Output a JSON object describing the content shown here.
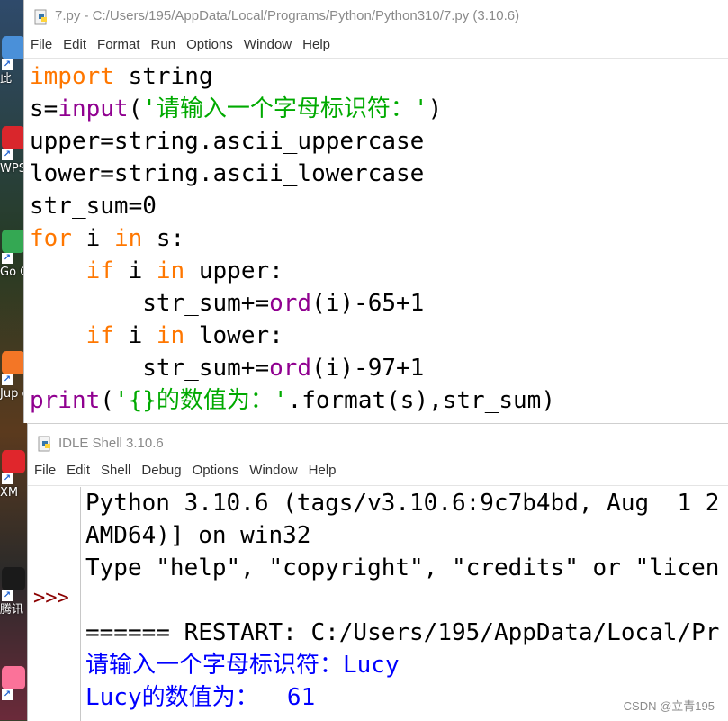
{
  "colors": {
    "keyword": "#ff7700",
    "builtin": "#900090",
    "string": "#00aa00",
    "text": "#000000",
    "stdout": "#0000ff",
    "prompt": "#8b0000"
  },
  "desktop": {
    "icons": [
      {
        "icon": "computer-icon",
        "label": "此",
        "color": "#4a90d9"
      },
      {
        "icon": "wps-icon",
        "label": "WPS",
        "color": "#d9262c"
      },
      {
        "icon": "chrome-icon",
        "label": "Go Chr",
        "color": "#34a853"
      },
      {
        "icon": "jupyter-icon",
        "label": "Jup ote",
        "color": "#f37626"
      },
      {
        "icon": "xmind-icon",
        "label": "XM",
        "color": "#e0262c"
      },
      {
        "icon": "qq-icon",
        "label": "腾讯",
        "color": "#1a1a1a"
      },
      {
        "icon": "bilibili-icon",
        "label": "",
        "color": "#fb7299"
      }
    ]
  },
  "editor": {
    "title": "7.py - C:/Users/195/AppData/Local/Programs/Python/Python310/7.py (3.10.6)",
    "menu": [
      "File",
      "Edit",
      "Format",
      "Run",
      "Options",
      "Window",
      "Help"
    ],
    "lines": [
      [
        {
          "t": "import",
          "c": "keyword"
        },
        {
          "t": " string",
          "c": "text"
        }
      ],
      [
        {
          "t": "s=",
          "c": "text"
        },
        {
          "t": "input",
          "c": "builtin"
        },
        {
          "t": "(",
          "c": "text"
        },
        {
          "t": "'请输入一个字母标识符：'",
          "c": "string"
        },
        {
          "t": ")",
          "c": "text"
        }
      ],
      [
        {
          "t": "upper=string.ascii_uppercase",
          "c": "text"
        }
      ],
      [
        {
          "t": "lower=string.ascii_lowercase",
          "c": "text"
        }
      ],
      [
        {
          "t": "str_sum=0",
          "c": "text"
        }
      ],
      [
        {
          "t": "for",
          "c": "keyword"
        },
        {
          "t": " i ",
          "c": "text"
        },
        {
          "t": "in",
          "c": "keyword"
        },
        {
          "t": " s:",
          "c": "text"
        }
      ],
      [
        {
          "t": "    ",
          "c": "text"
        },
        {
          "t": "if",
          "c": "keyword"
        },
        {
          "t": " i ",
          "c": "text"
        },
        {
          "t": "in",
          "c": "keyword"
        },
        {
          "t": " upper:",
          "c": "text"
        }
      ],
      [
        {
          "t": "        str_sum+=",
          "c": "text"
        },
        {
          "t": "ord",
          "c": "builtin"
        },
        {
          "t": "(i)-65+1",
          "c": "text"
        }
      ],
      [
        {
          "t": "    ",
          "c": "text"
        },
        {
          "t": "if",
          "c": "keyword"
        },
        {
          "t": " i ",
          "c": "text"
        },
        {
          "t": "in",
          "c": "keyword"
        },
        {
          "t": " lower:",
          "c": "text"
        }
      ],
      [
        {
          "t": "        str_sum+=",
          "c": "text"
        },
        {
          "t": "ord",
          "c": "builtin"
        },
        {
          "t": "(i)-97+1",
          "c": "text"
        }
      ],
      [
        {
          "t": "print",
          "c": "builtin"
        },
        {
          "t": "(",
          "c": "text"
        },
        {
          "t": "'{}的数值为：'",
          "c": "string"
        },
        {
          "t": ".format(s),str_sum)",
          "c": "text"
        }
      ]
    ]
  },
  "shell": {
    "title": "IDLE Shell 3.10.6",
    "menu": [
      "File",
      "Edit",
      "Shell",
      "Debug",
      "Options",
      "Window",
      "Help"
    ],
    "prompt": ">>>",
    "lines": [
      {
        "t": "Python 3.10.6 (tags/v3.10.6:9c7b4bd, Aug  1 2",
        "c": "text"
      },
      {
        "t": "AMD64)] on win32",
        "c": "text"
      },
      {
        "t": "Type \"help\", \"copyright\", \"credits\" or \"licen",
        "c": "text"
      },
      {
        "t": "",
        "c": "text"
      },
      {
        "t": "====== RESTART: C:/Users/195/AppData/Local/Pr",
        "c": "text"
      },
      {
        "t": "请输入一个字母标识符：Lucy",
        "c": "stdout"
      },
      {
        "t": "Lucy的数值为：  61",
        "c": "stdout"
      }
    ]
  },
  "watermark": "CSDN @立青195"
}
